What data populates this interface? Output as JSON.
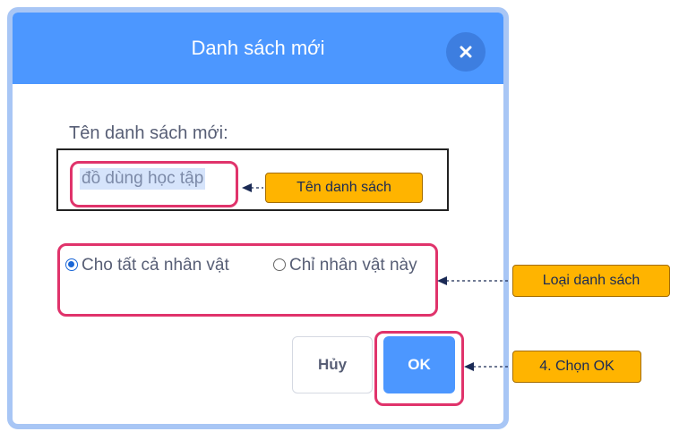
{
  "dialog": {
    "title": "Danh sách mới",
    "close_icon": "close-icon",
    "prompt": "Tên danh sách mới:",
    "list_name_value": "đồ dùng học tập",
    "radio_options": [
      {
        "label": "Cho tất cả nhân vật",
        "checked": true
      },
      {
        "label": "Chỉ nhân vật này",
        "checked": false
      }
    ],
    "cancel_label": "Hủy",
    "ok_label": "OK"
  },
  "annotations": {
    "name_tag": "Tên danh sách",
    "type_tag": "Loại danh sách",
    "ok_tag": "4. Chọn OK"
  },
  "colors": {
    "header_blue": "#4c97ff",
    "highlight_pink": "#e0336b",
    "tag_orange": "#ffb400"
  }
}
